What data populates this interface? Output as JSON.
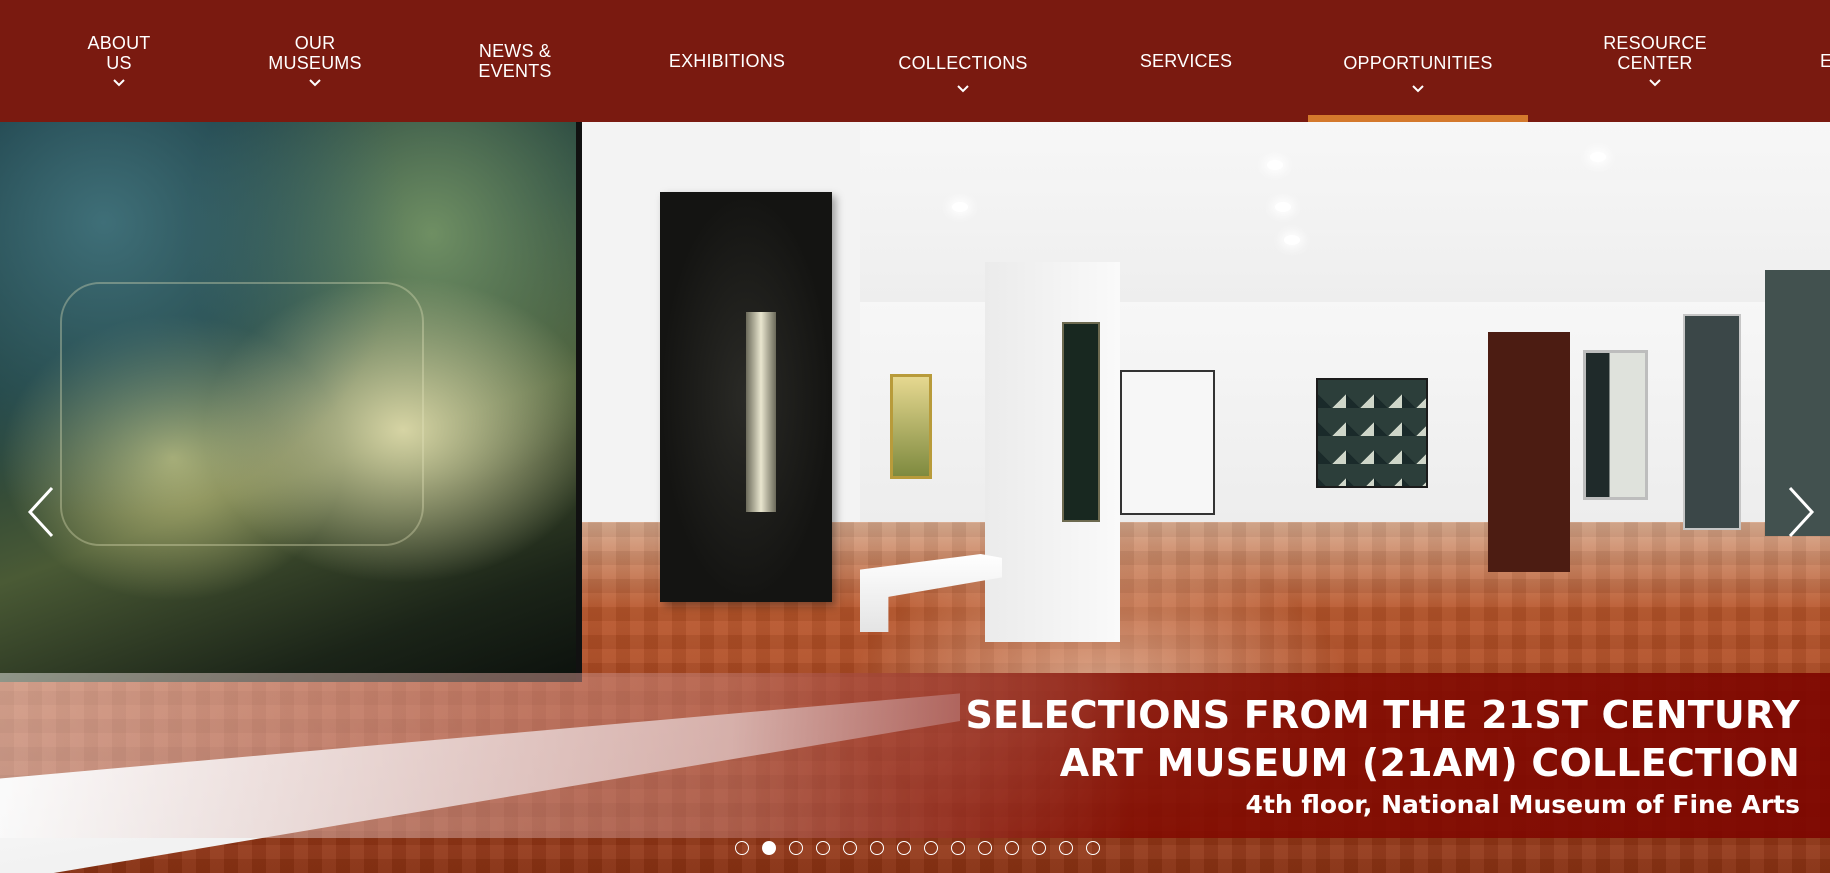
{
  "nav": {
    "items": [
      {
        "label": "ABOUT\nUS",
        "has_dropdown": true,
        "active": false
      },
      {
        "label": "OUR\nMUSEUMS",
        "has_dropdown": true,
        "active": false
      },
      {
        "label": "NEWS &\nEVENTS",
        "has_dropdown": false,
        "active": false
      },
      {
        "label": "EXHIBITIONS",
        "has_dropdown": false,
        "active": false
      },
      {
        "label": "COLLECTIONS",
        "has_dropdown": true,
        "active": false
      },
      {
        "label": "SERVICES",
        "has_dropdown": false,
        "active": false
      },
      {
        "label": "OPPORTUNITIES",
        "has_dropdown": true,
        "active": true
      },
      {
        "label": "RESOURCE\nCENTER",
        "has_dropdown": true,
        "active": false
      },
      {
        "label": "E",
        "has_dropdown": false,
        "active": false
      }
    ]
  },
  "hero": {
    "caption_title_line1": "SELECTIONS FROM THE 21ST CENTURY",
    "caption_title_line2": "ART MUSEUM (21AM) COLLECTION",
    "caption_subtitle": "4th floor, National Museum of Fine Arts",
    "prev_icon": "chevron-left-icon",
    "next_icon": "chevron-right-icon",
    "slide_count": 14,
    "active_slide": 2
  },
  "colors": {
    "nav_background": "#7a1a10",
    "nav_active_indicator": "#d4792c",
    "caption_background": "#7d0500",
    "text_white": "#ffffff"
  }
}
